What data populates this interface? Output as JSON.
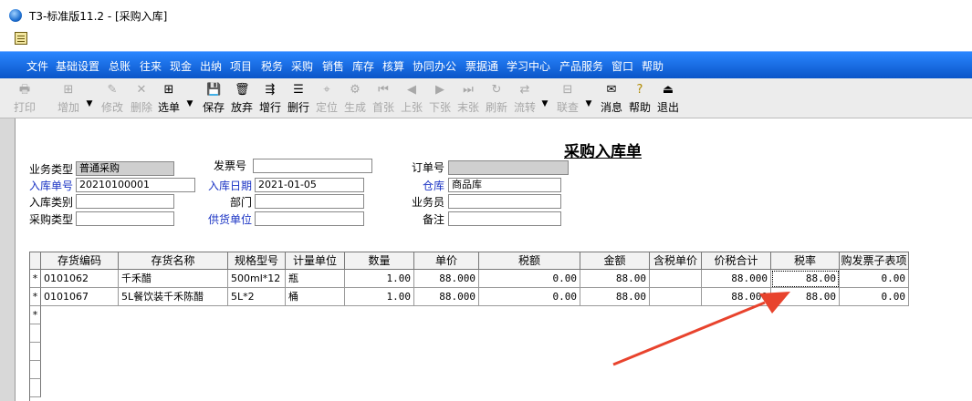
{
  "window": {
    "title": "T3-标准版11.2 - [采购入库]"
  },
  "menu": [
    "文件",
    "基础设置",
    "总账",
    "往来",
    "现金",
    "出纳",
    "项目",
    "税务",
    "采购",
    "销售",
    "库存",
    "核算",
    "协同办公",
    "票据通",
    "学习中心",
    "产品服务",
    "窗口",
    "帮助"
  ],
  "toolbar": {
    "print": "打印",
    "add": "增加",
    "modify": "修改",
    "delete": "删除",
    "select": "选单",
    "save": "保存",
    "discard": "放弃",
    "add_row": "增行",
    "delete_row": "删行",
    "locate": "定位",
    "generate": "生成",
    "first": "首张",
    "prev": "上张",
    "next": "下张",
    "last": "末张",
    "refresh": "刷新",
    "flow": "流转",
    "query": "联查",
    "message": "消息",
    "help": "帮助",
    "exit": "退出"
  },
  "form": {
    "title": "采购入库单",
    "business_type_label": "业务类型",
    "business_type": "普通采购",
    "invoice_no_label": "发票号",
    "invoice_no": "",
    "order_no_label": "订单号",
    "order_no": "",
    "receipt_no_label": "入库单号",
    "receipt_no": "20210100001",
    "receipt_date_label": "入库日期",
    "receipt_date": "2021-01-05",
    "warehouse_label": "仓库",
    "warehouse": "商品库",
    "receipt_category_label": "入库类别",
    "receipt_category": "",
    "department_label": "部门",
    "department": "",
    "salesperson_label": "业务员",
    "salesperson": "",
    "purchase_type_label": "采购类型",
    "purchase_type": "",
    "supplier_label": "供货单位",
    "supplier": "",
    "remark_label": "备注",
    "remark": ""
  },
  "grid": {
    "headers": [
      "存货编码",
      "存货名称",
      "规格型号",
      "计量单位",
      "数量",
      "单价",
      "税额",
      "金额",
      "含税单价",
      "价税合计",
      "税率",
      "购发票子表项"
    ],
    "rows": [
      {
        "marker": "*",
        "code": "0101062",
        "name": "千禾醋",
        "spec": "500ml*12",
        "unit": "瓶",
        "qty": "1.00",
        "price": "88.000",
        "tax": "0.00",
        "amount": "88.00",
        "tax_price": "",
        "total": "88.000",
        "rate": "88.00",
        "sub": "0.00"
      },
      {
        "marker": "*",
        "code": "0101067",
        "name": "5L餐饮装千禾陈醋",
        "spec": "5L*2",
        "unit": "桶",
        "qty": "1.00",
        "price": "88.000",
        "tax": "0.00",
        "amount": "88.00",
        "tax_price": "",
        "total": "88.000",
        "rate": "88.00",
        "sub": "0.00"
      }
    ],
    "new_row_marker": "*"
  },
  "colors": {
    "menubar": "#0a55c8",
    "required_label": "#1a33c4",
    "arrow": "#e8432d"
  }
}
